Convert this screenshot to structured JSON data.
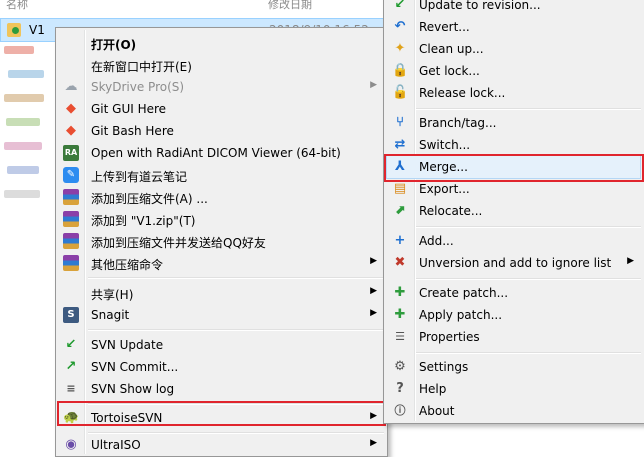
{
  "explorer": {
    "col_name": "名称",
    "col_date": "修改日期",
    "selected_file": {
      "name": "V1",
      "date": "2018/9/10 16:52"
    }
  },
  "main_menu": {
    "items": [
      {
        "label": "打开(O)",
        "icon": "folder-open-icon"
      },
      {
        "label": "在新窗口中打开(E)",
        "icon": ""
      },
      {
        "label": "SkyDrive Pro(S)",
        "icon": "cloud-icon"
      },
      {
        "label": "Git GUI Here",
        "icon": "git-icon"
      },
      {
        "label": "Git Bash Here",
        "icon": "git-icon"
      },
      {
        "label": "Open with RadiAnt DICOM Viewer (64-bit)",
        "icon": "radiant-icon"
      },
      {
        "label": "上传到有道云笔记",
        "icon": "youdao-icon"
      },
      {
        "label": "添加到压缩文件(A) ...",
        "icon": "winrar-icon"
      },
      {
        "label": "添加到 \"V1.zip\"(T)",
        "icon": "winrar-icon"
      },
      {
        "label": "添加到压缩文件并发送给QQ好友",
        "icon": "winrar-icon"
      },
      {
        "label": "其他压缩命令",
        "icon": "winrar-icon"
      },
      {
        "label": "共享(H)",
        "icon": ""
      },
      {
        "label": "Snagit",
        "icon": "snagit-icon"
      },
      {
        "label": "SVN Update",
        "icon": "svn-update-icon"
      },
      {
        "label": "SVN Commit...",
        "icon": "svn-commit-icon"
      },
      {
        "label": "SVN Show log",
        "icon": "svn-log-icon"
      },
      {
        "label": "TortoiseSVN",
        "icon": "tortoise-icon"
      },
      {
        "label": "UltraISO",
        "icon": "ultraiso-icon"
      }
    ]
  },
  "sub_menu": {
    "items": [
      {
        "label": "Update to revision..."
      },
      {
        "label": "Revert..."
      },
      {
        "label": "Clean up..."
      },
      {
        "label": "Get lock..."
      },
      {
        "label": "Release lock..."
      },
      {
        "label": "Branch/tag..."
      },
      {
        "label": "Switch..."
      },
      {
        "label": "Merge..."
      },
      {
        "label": "Export..."
      },
      {
        "label": "Relocate..."
      },
      {
        "label": "Add..."
      },
      {
        "label": "Unversion and add to ignore list"
      },
      {
        "label": "Create patch..."
      },
      {
        "label": "Apply patch..."
      },
      {
        "label": "Properties"
      },
      {
        "label": "Settings"
      },
      {
        "label": "Help"
      },
      {
        "label": "About"
      }
    ]
  },
  "colors": {
    "highlight_border": "#e0252d",
    "selection": "#cce8ff"
  }
}
